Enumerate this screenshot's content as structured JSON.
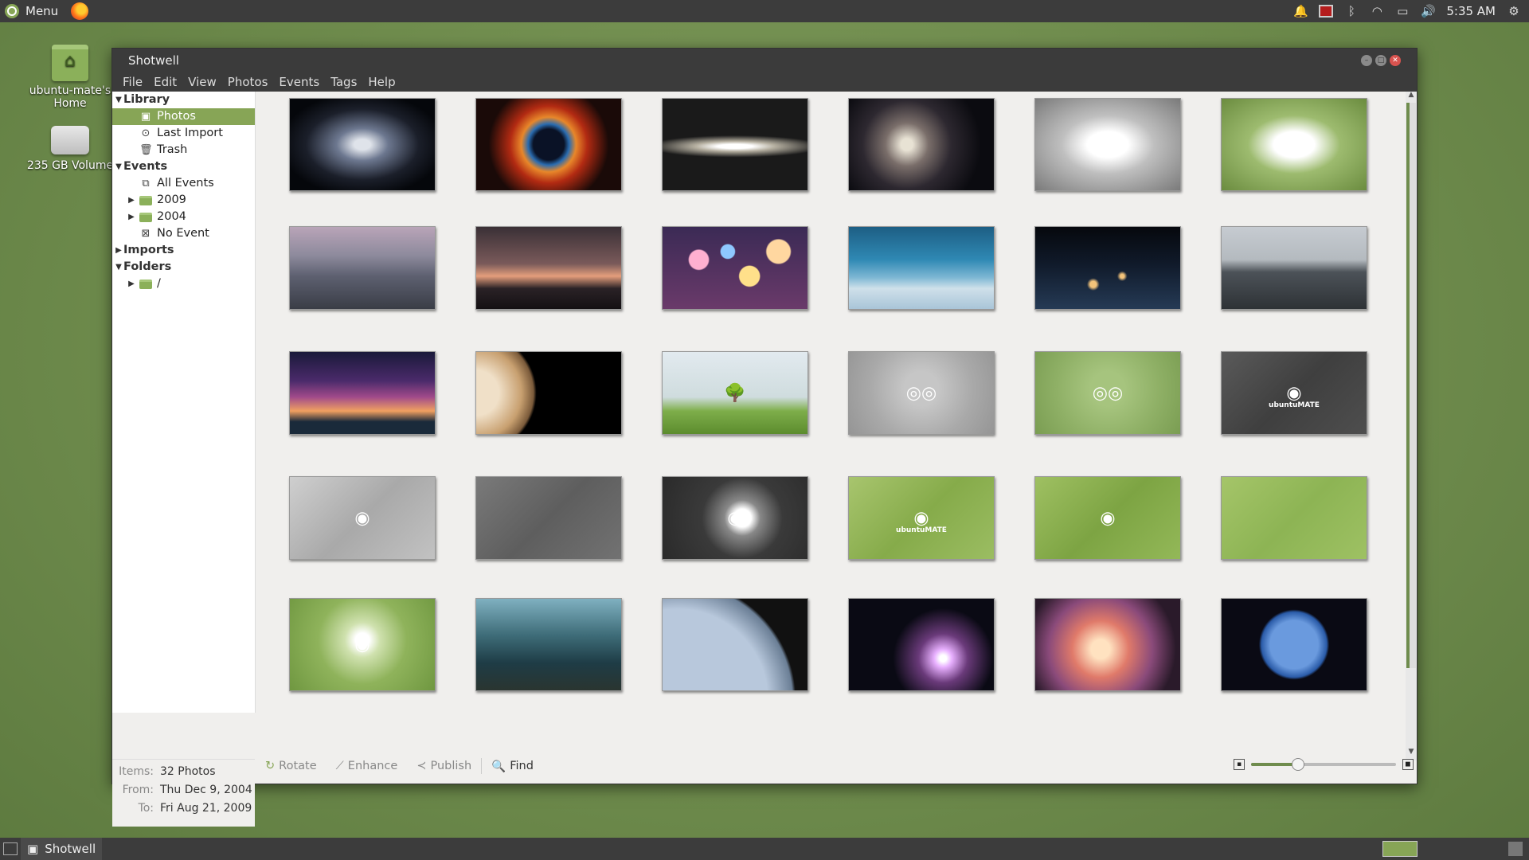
{
  "top_panel": {
    "menu_label": "Menu",
    "clock": "5:35 AM",
    "tray_icons": [
      "bell-icon",
      "screen-record-icon",
      "bluetooth-icon",
      "wifi-icon",
      "battery-icon",
      "volume-icon",
      "settings-icon"
    ]
  },
  "desktop": {
    "home_label": "ubuntu-mate's Home",
    "volume_label": "235 GB Volume"
  },
  "window": {
    "title": "Shotwell",
    "menus": [
      "File",
      "Edit",
      "View",
      "Photos",
      "Events",
      "Tags",
      "Help"
    ]
  },
  "sidebar": {
    "library": "Library",
    "photos": "Photos",
    "last_import": "Last Import",
    "trash": "Trash",
    "events": "Events",
    "all_events": "All Events",
    "year_2009": "2009",
    "year_2004": "2004",
    "no_event": "No Event",
    "imports": "Imports",
    "folders": "Folders",
    "root_folder": "/"
  },
  "stats": {
    "items_label": "Items:",
    "items_value": "32 Photos",
    "from_label": "From:",
    "from_value": "Thu Dec 9, 2004",
    "to_label": "To:",
    "to_value": "Fri Aug 21, 2009"
  },
  "toolbar": {
    "rotate": "Rotate",
    "enhance": "Enhance",
    "publish": "Publish",
    "find": "Find",
    "zoom_level": 0.32
  },
  "thumbnails": [
    {
      "bg": "radial-gradient(ellipse at 50% 50%, #dfe3ea 0 8%, #6d7890 25%, #1b1f2a 55%, #05070b 80%)"
    },
    {
      "bg": "radial-gradient(circle at 50% 50%, #0a1226 0 18%, #2a6cb0 24%, #e8872a 32%, #b22a12 45%, #1a0a08 70%)"
    },
    {
      "bg": "radial-gradient(ellipse 60% 12% at 50% 52%, #fff 0 20%, #b7b1a2 45%, #1a1a1a 100%)"
    },
    {
      "bg": "radial-gradient(circle at 40% 50%, #e8e2d4 0 6%, #7a6e6a 22%, #2d2830 45%, #0b0b10 75%)"
    },
    {
      "bg": "radial-gradient(ellipse at 50% 50%, #ffffff 0 20%, #bfbfbf 45%, #7a7a7a 100%)",
      "glyph": "◉"
    },
    {
      "bg": "radial-gradient(ellipse at 50% 50%, #ffffff 0 20%, #9dbb6f 45%, #6b8c3f 100%)",
      "glyph": "◉"
    },
    {
      "bg": "linear-gradient(#b9a4b8 0%, #8d8a9c 35%, #5d6070 60%, #3a3d46 100%)"
    },
    {
      "bg": "linear-gradient(#3a3036 0%, #7a5a5a 45%, #e49e7c 60%, #2a2226 75%, #141013 100%)"
    },
    {
      "bg": "radial-gradient(circle at 25% 40%, #ffb0d0 0 8%, transparent 9%), radial-gradient(circle at 60% 60%, #ffe08a 0 10%, transparent 11%), radial-gradient(circle at 80% 30%, #ffd7a0 0 9%, transparent 10%), radial-gradient(circle at 45% 30%, #8ec8ff 0 7%, transparent 8%), linear-gradient(#3b2a55, #6a3a6a)"
    },
    {
      "bg": "linear-gradient(#1d5e84 0%, #2f89b4 40%, #7fb8d4 62%, #cfe0ea 75%, #a9c5d8 100%)"
    },
    {
      "bg": "radial-gradient(circle at 40% 70%, #f3c37a 0 3%, transparent 6%), radial-gradient(circle at 60% 60%, #f3c37a 0 2%, transparent 5%), linear-gradient(#06080d 0%, #101a2a 45%, #253a55 100%)"
    },
    {
      "bg": "linear-gradient(#c6cbd1 0%, #b4babf 40%, #4c5258 55%, #2e3236 100%)"
    },
    {
      "bg": "linear-gradient(#1a1a3a 0%, #4a2a6a 35%, #a04a8a 55%, #f0a060 72%, #1a2a3a 85%)"
    },
    {
      "bg": "radial-gradient(circle at 0% 50%, #f0e0c8 0 15%, #c8a070 30%, #7a5a3a 38%, #000 40%)"
    },
    {
      "bg": "linear-gradient(#e2eaef 0%, #cfdcde 55%, #7eae4a 72%, #5c8c2e 100%)",
      "glyph": "🌳"
    },
    {
      "bg": "radial-gradient(circle at 50% 45%, #c6c6c6 0 20%, #a9a9a9 60%, #959595 100%)",
      "glyph": "◎◎"
    },
    {
      "bg": "radial-gradient(circle at 50% 45%, #a6c47e 0 20%, #8fb066 60%, #7a9d52 100%)",
      "glyph": "◎◎"
    },
    {
      "bg": "linear-gradient(135deg, #5a5a5a 0%, #3f3f3f 50%, #4e4e4e 100%)",
      "glyph": "◉",
      "caption": "ubuntuMATE"
    },
    {
      "bg": "linear-gradient(135deg, #cfcfcf 0%, #a9a9a9 50%, #c2c2c2 100%)",
      "glyph": "◉"
    },
    {
      "bg": "linear-gradient(135deg, #7a7a7a 0%, #5e5e5e 50%, #727272 100%)"
    },
    {
      "bg": "radial-gradient(circle at 55% 50%, #fff 0 10%, #888 20%, #3a3a3a 45%, #2a2a2a 100%)",
      "glyph": "◉"
    },
    {
      "bg": "linear-gradient(135deg, #a8c56e 0%, #86ab4a 50%, #9bbd62 100%)",
      "glyph": "◉",
      "caption": "ubuntuMATE"
    },
    {
      "bg": "linear-gradient(135deg, #9fc062 0%, #7da443 50%, #93b858 100%)",
      "glyph": "◉"
    },
    {
      "bg": "linear-gradient(135deg, #a5c569 0%, #8db454 50%, #9ec163 100%)"
    },
    {
      "bg": "radial-gradient(circle at 50% 45%, #fff 0 8%, #cfe1ae 20%, #8fb35b 50%, #6f9740 100%)",
      "glyph": "◉"
    },
    {
      "bg": "linear-gradient(#7fb0c0 0%, #3e6c78 40%, #1e3c46 70%, #2a3530 100%)"
    },
    {
      "bg": "radial-gradient(circle at 10% 110%, #b8c8dc 0 55%, #6b7f96 70%, #111 72%)"
    },
    {
      "bg": "radial-gradient(circle at 65% 65%, #fff 0 3%, #e8b0ff 8%, #6a3a7a 22%, #0a0a14 45%)"
    },
    {
      "bg": "radial-gradient(circle at 45% 55%, #ffe2c0 0 10%, #e07a6a 30%, #8a4a7a 55%, #2a1a2a 80%)"
    },
    {
      "bg": "radial-gradient(circle at 50% 50%, #6a9ade 0 28%, #2a5ba8 38%, #0a0a14 41%)"
    },
    {
      "bg": "radial-gradient(circle at 70% 30%, #a7c8ff 0 10%, #3a6cc8 35%, #1a3a8a 70%)"
    },
    {
      "bg": "linear-gradient(#e9eef0 0%, #c8d3d6 35%, #5b7a3c 70%, #3a5a2a 100%)"
    }
  ],
  "bottom_panel": {
    "task_label": "Shotwell"
  }
}
